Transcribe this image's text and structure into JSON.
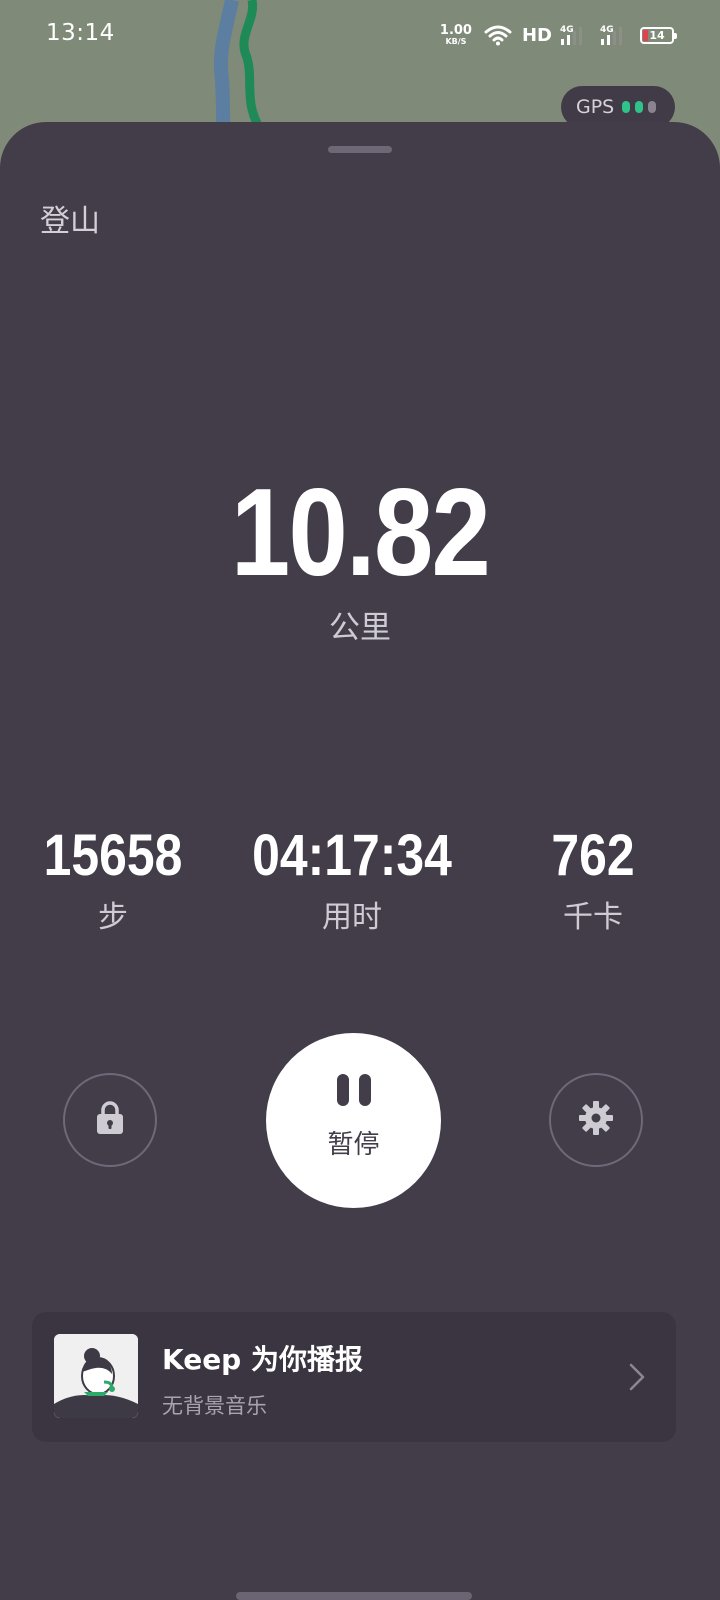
{
  "status_bar": {
    "time": "13:14",
    "net_speed_value": "1.00",
    "net_speed_unit": "KB/S",
    "hd_label": "HD",
    "signal_1_label": "4G",
    "signal_2_label": "4G",
    "battery_level": "14",
    "icons": [
      "wifi-icon",
      "signal-icon",
      "signal-icon",
      "battery-icon"
    ]
  },
  "gps": {
    "label": "GPS",
    "signal_strength": "2 of 3",
    "dot_color_active": "#2fc38a",
    "dot_color_inactive": "#8a8490"
  },
  "workout": {
    "activity_type": "登山",
    "distance_value": "10.82",
    "distance_unit": "公里",
    "stats": [
      {
        "value": "15658",
        "label": "步"
      },
      {
        "value": "04:17:34",
        "label": "用时"
      },
      {
        "value": "762",
        "label": "千卡"
      }
    ]
  },
  "controls": {
    "lock_icon": "lock-icon",
    "pause_label": "暂停",
    "pause_icon": "pause-icon",
    "settings_icon": "gear-icon"
  },
  "voice_card": {
    "title": "Keep 为你播报",
    "subtitle": "无背景音乐",
    "avatar_icon": "announcer-avatar",
    "chevron_icon": "chevron-right-icon"
  },
  "colors": {
    "sheet_bg": "#433d4a",
    "card_bg": "#3b3541",
    "route_green": "#1e8a55",
    "route_blue": "#5c7ea0",
    "map_bg": "#7f8a78"
  }
}
